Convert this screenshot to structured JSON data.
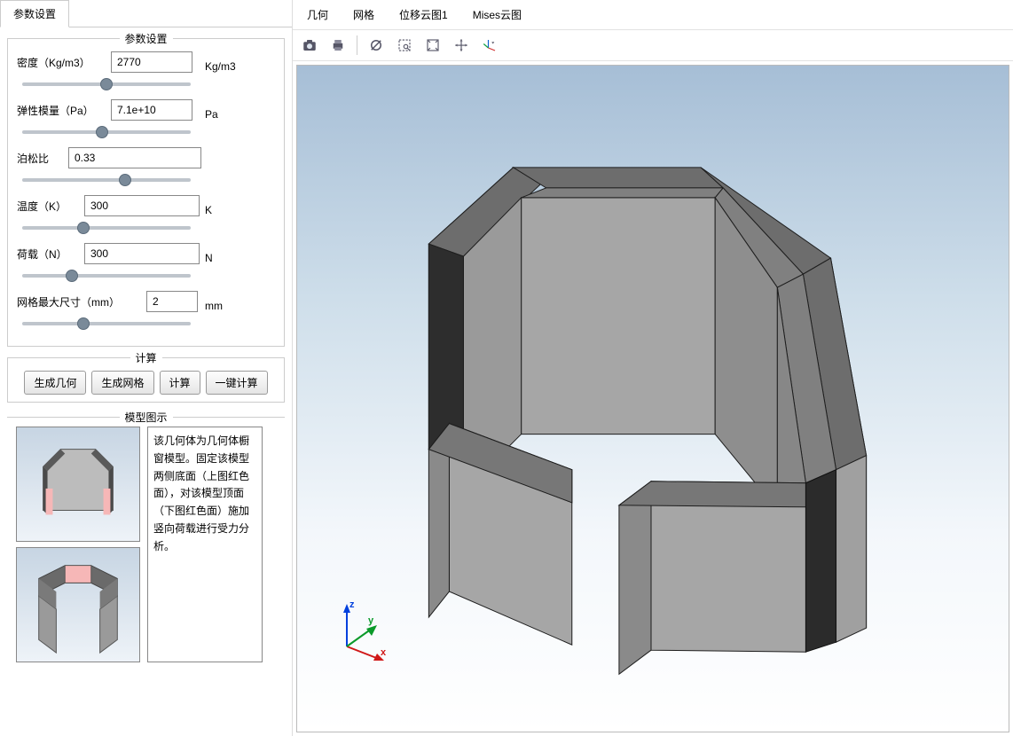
{
  "sidebar": {
    "tab_label": "参数设置",
    "params_group_title": "参数设置",
    "compute_group_title": "计算",
    "model_group_title": "模型图示",
    "params": {
      "density": {
        "label": "密度（Kg/m3）",
        "value": "2770",
        "unit": "Kg/m3"
      },
      "modulus": {
        "label": "弹性模量（Pa）",
        "value": "7.1e+10",
        "unit": "Pa"
      },
      "poisson": {
        "label": "泊松比",
        "value": "0.33",
        "unit": ""
      },
      "temp": {
        "label": "温度（K）",
        "value": "300",
        "unit": "K"
      },
      "load": {
        "label": "荷载（N）",
        "value": "300",
        "unit": "N"
      },
      "mesh": {
        "label": "网格最大尺寸（mm）",
        "value": "2",
        "unit": "mm"
      }
    },
    "buttons": {
      "gen_geom": "生成几何",
      "gen_mesh": "生成网格",
      "compute": "计算",
      "one_click": "一键计算"
    },
    "description": "该几何体为几何体橱窗模型。固定该模型两侧底面（上图红色面），对该模型顶面（下图红色面）施加竖向荷载进行受力分析。"
  },
  "main": {
    "tabs": [
      "几何",
      "网格",
      "位移云图1",
      "Mises云图"
    ],
    "active_tab_index": 0,
    "triad": {
      "x": "x",
      "y": "y",
      "z": "z"
    },
    "tooltips": {
      "camera": "截图",
      "print": "打印",
      "reset": "重置视图",
      "zoom_box": "框选缩放",
      "fit": "适应窗口",
      "pan": "平移",
      "axes": "坐标轴"
    }
  }
}
